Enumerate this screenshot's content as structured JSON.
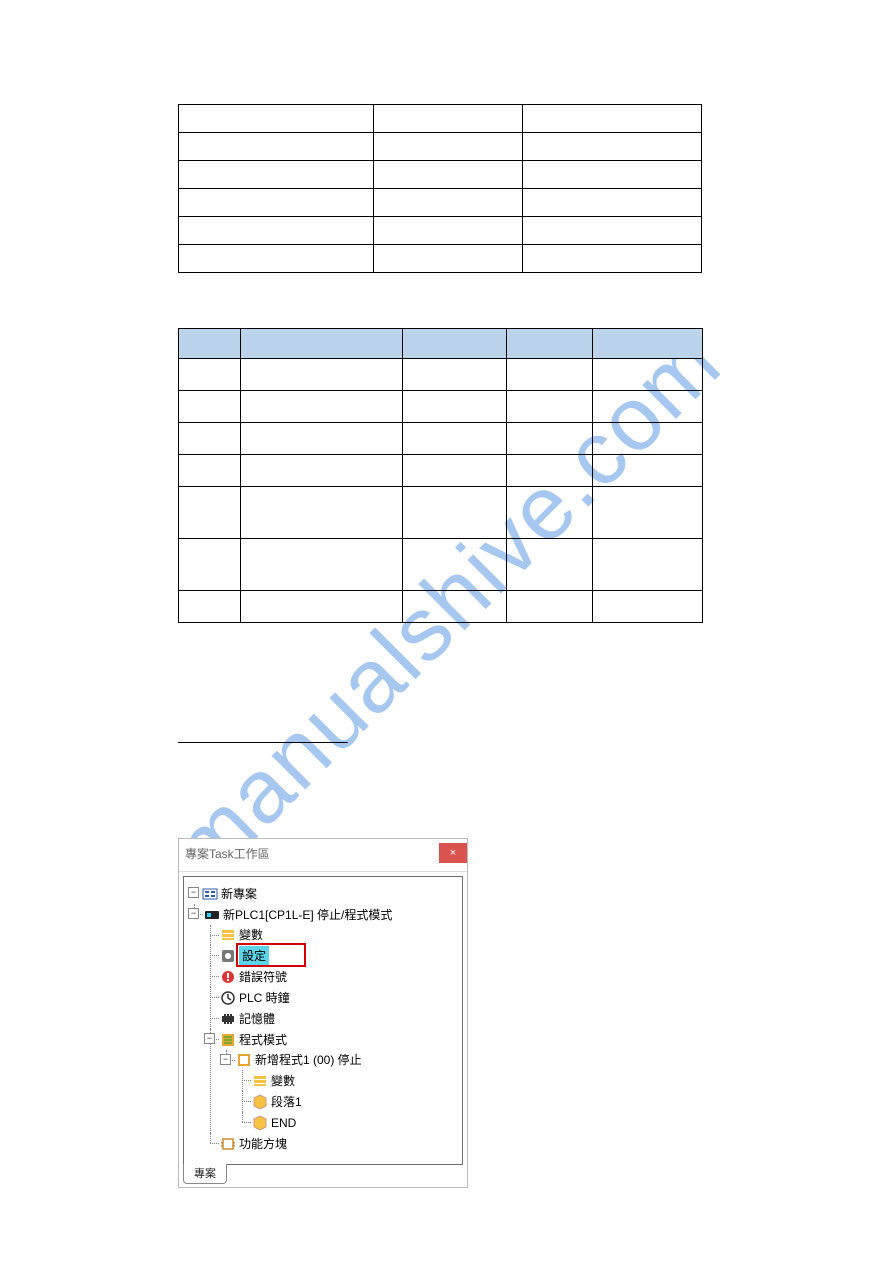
{
  "watermark": "manualshive.com",
  "panel": {
    "title": "專案Task工作區",
    "close_label": "×",
    "tab_label": "專案"
  },
  "tree": {
    "root": "新專案",
    "plc": "新PLC1[CP1L-E] 停止/程式模式",
    "variables": "變數",
    "settings": "設定",
    "error_symbol": "錯誤符號",
    "plc_clock": "PLC 時鐘",
    "memory": "記憶體",
    "program_mode": "程式模式",
    "new_program": "新增程式1 (00) 停止",
    "variables2": "變數",
    "section1": "段落1",
    "end": "END",
    "function_block": "功能方塊"
  },
  "expander": {
    "minus": "−",
    "plus": "+"
  }
}
